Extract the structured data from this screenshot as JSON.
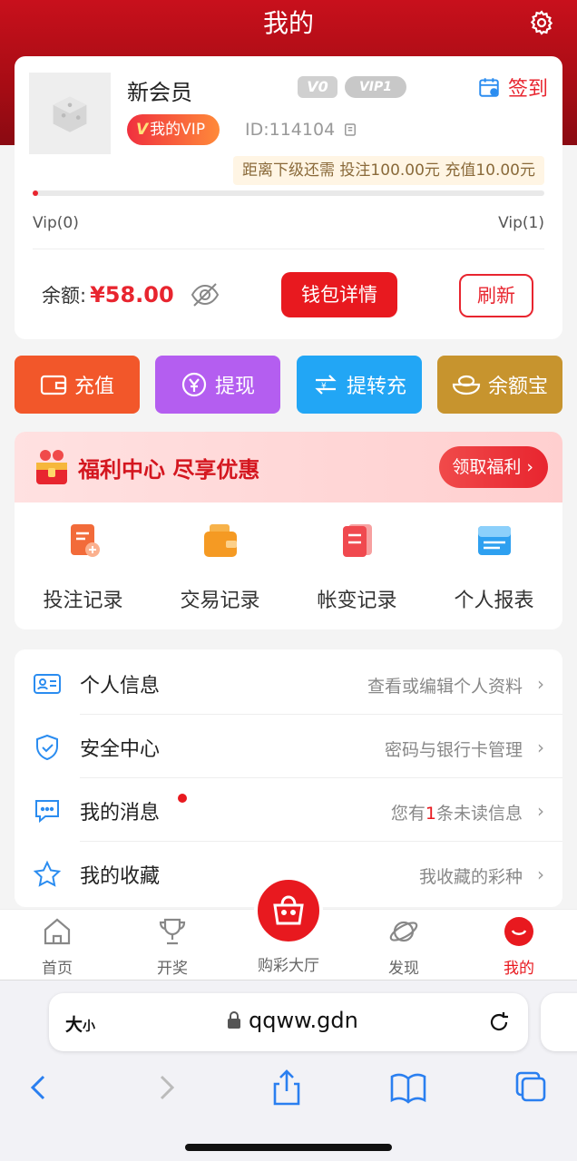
{
  "header": {
    "title": "我的"
  },
  "member": {
    "username": "新会员",
    "level_badge": "V0",
    "vip_badge": "VIP1",
    "signin_label": "签到",
    "myvip_label": "我的VIP",
    "myvip_mark": "V",
    "user_id": "ID:114104",
    "next_level_text": "距离下级还需  投注100.00元  充值10.00元",
    "progress_fraction": 0.0,
    "vip_current": "Vip(0)",
    "vip_next": "Vip(1)",
    "balance_label": "余额:",
    "balance_amount": "¥58.00",
    "wallet_button": "钱包详情",
    "refresh_button": "刷新"
  },
  "actions": [
    {
      "label": "充值",
      "icon": "wallet-icon",
      "color": "#f2572a"
    },
    {
      "label": "提现",
      "icon": "yen-withdraw-icon",
      "color": "#b45ef0"
    },
    {
      "label": "提转充",
      "icon": "transfer-icon",
      "color": "#22a6f5"
    },
    {
      "label": "余额宝",
      "icon": "ingot-icon",
      "color": "#c7942e"
    }
  ],
  "welfare": {
    "title": "福利中心 尽享优惠",
    "button": "领取福利",
    "records": [
      {
        "label": "投注记录",
        "icon": "bet-record-icon"
      },
      {
        "label": "交易记录",
        "icon": "transaction-record-icon"
      },
      {
        "label": "帐变记录",
        "icon": "account-change-icon"
      },
      {
        "label": "个人报表",
        "icon": "personal-report-icon"
      }
    ]
  },
  "menu": [
    {
      "title": "个人信息",
      "desc": "查看或编辑个人资料",
      "icon": "id-card-icon"
    },
    {
      "title": "安全中心",
      "desc": "密码与银行卡管理",
      "icon": "shield-icon"
    },
    {
      "title": "我的消息",
      "desc_prefix": "您有",
      "desc_num": "1",
      "desc_suffix": "条未读信息",
      "icon": "message-icon"
    },
    {
      "title": "我的收藏",
      "desc": "我收藏的彩种",
      "icon": "star-icon"
    }
  ],
  "tabbar": {
    "home": "首页",
    "lottery_results": "开奖",
    "center": "购彩大厅",
    "discover": "发现",
    "mine": "我的"
  },
  "browser": {
    "text_size": "大",
    "text_size_small": "小",
    "url": "qqww.gdn"
  },
  "colors": {
    "accent": "#e8191f",
    "hero": "#c8101c"
  }
}
